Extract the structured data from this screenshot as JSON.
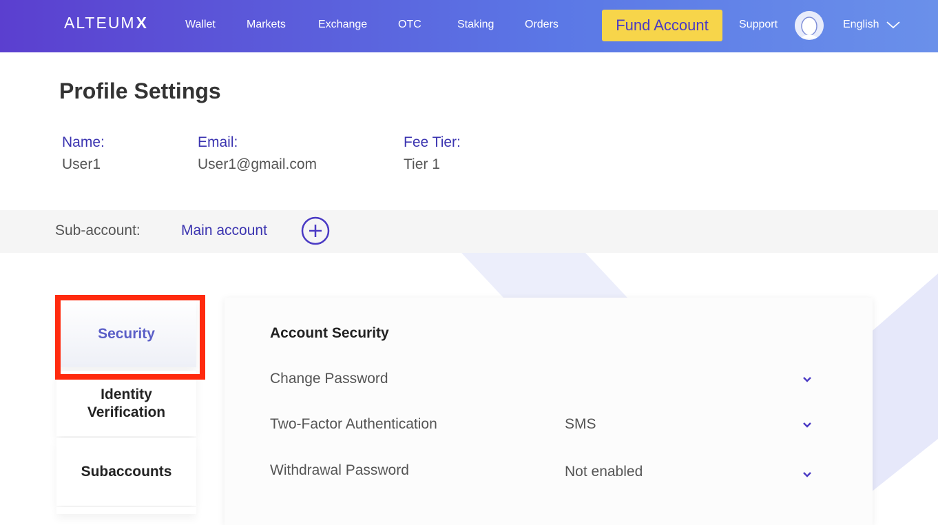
{
  "nav": {
    "logo_text": "ALTEUM",
    "logo_mark": "X",
    "items": [
      "Wallet",
      "Markets",
      "Exchange",
      "OTC",
      "Staking",
      "Orders"
    ],
    "fund_button": "Fund Account",
    "support": "Support",
    "language": "English"
  },
  "profile": {
    "title": "Profile Settings",
    "name_label": "Name:",
    "name_value": "User1",
    "email_label": "Email:",
    "email_value": "User1@gmail.com",
    "fee_label": "Fee Tier:",
    "fee_value": "Tier 1"
  },
  "subaccount": {
    "label": "Sub-account:",
    "value": "Main account"
  },
  "tabs": [
    {
      "label": "Security"
    },
    {
      "label": "Identity Verification"
    },
    {
      "label": "Subaccounts"
    }
  ],
  "security": {
    "title": "Account Security",
    "rows": [
      {
        "label": "Change Password",
        "value": ""
      },
      {
        "label": "Two-Factor Authentication",
        "value": "SMS"
      },
      {
        "label": "Withdrawal Password",
        "value": "Not enabled"
      }
    ]
  },
  "colors": {
    "accent": "#3b34b0",
    "fund_button": "#f7d54a",
    "highlight": "#ff2a0e"
  }
}
